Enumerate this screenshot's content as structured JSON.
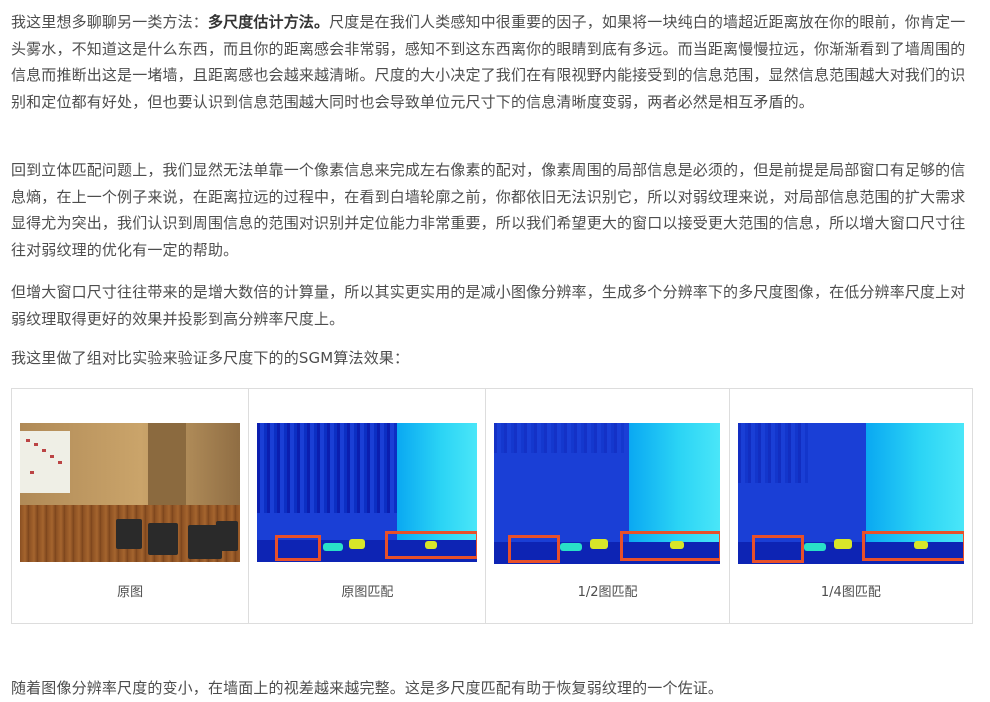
{
  "p1": {
    "lead": "我这里想多聊聊另一类方法：",
    "bold": "多尺度估计方法。",
    "rest": "尺度是在我们人类感知中很重要的因子，如果将一块纯白的墙超近距离放在你的眼前，你肯定一头雾水，不知道这是什么东西，而且你的距离感会非常弱，感知不到这东西离你的眼睛到底有多远。而当距离慢慢拉远，你渐渐看到了墙周围的信息而推断出这是一堵墙，且距离感也会越来越清晰。尺度的大小决定了我们在有限视野内能接受到的信息范围，显然信息范围越大对我们的识别和定位都有好处，但也要认识到信息范围越大同时也会导致单位元尺寸下的信息清晰度变弱，两者必然是相互矛盾的。"
  },
  "p2": "回到立体匹配问题上，我们显然无法单靠一个像素信息来完成左右像素的配对，像素周围的局部信息是必须的，但是前提是局部窗口有足够的信息熵，在上一个例子来说，在距离拉远的过程中，在看到白墙轮廓之前，你都依旧无法识别它，所以对弱纹理来说，对局部信息范围的扩大需求显得尤为突出，我们认识到周围信息的范围对识别并定位能力非常重要，所以我们希望更大的窗口以接受更大范围的信息，所以增大窗口尺寸往往对弱纹理的优化有一定的帮助。",
  "p3": "但增大窗口尺寸往往带来的是增大数倍的计算量，所以其实更实用的是减小图像分辨率，生成多个分辨率下的多尺度图像，在低分辨率尺度上对弱纹理取得更好的效果并投影到高分辨率尺度上。",
  "p4": "我这里做了组对比实验来验证多尺度下的的SGM算法效果：",
  "captions": [
    "原图",
    "原图匹配",
    "1/2图匹配",
    "1/4图匹配"
  ],
  "p5": "随着图像分辨率尺度的变小，在墙面上的视差越来越完整。这是多尺度匹配有助于恢复弱纹理的一个佐证。",
  "colors": {
    "text": "#4d4d4d",
    "border": "#dddddd",
    "disparity_low": "#1a3fd6",
    "disparity_high": "#4ae6f8",
    "frame_red": "#e8502a"
  }
}
